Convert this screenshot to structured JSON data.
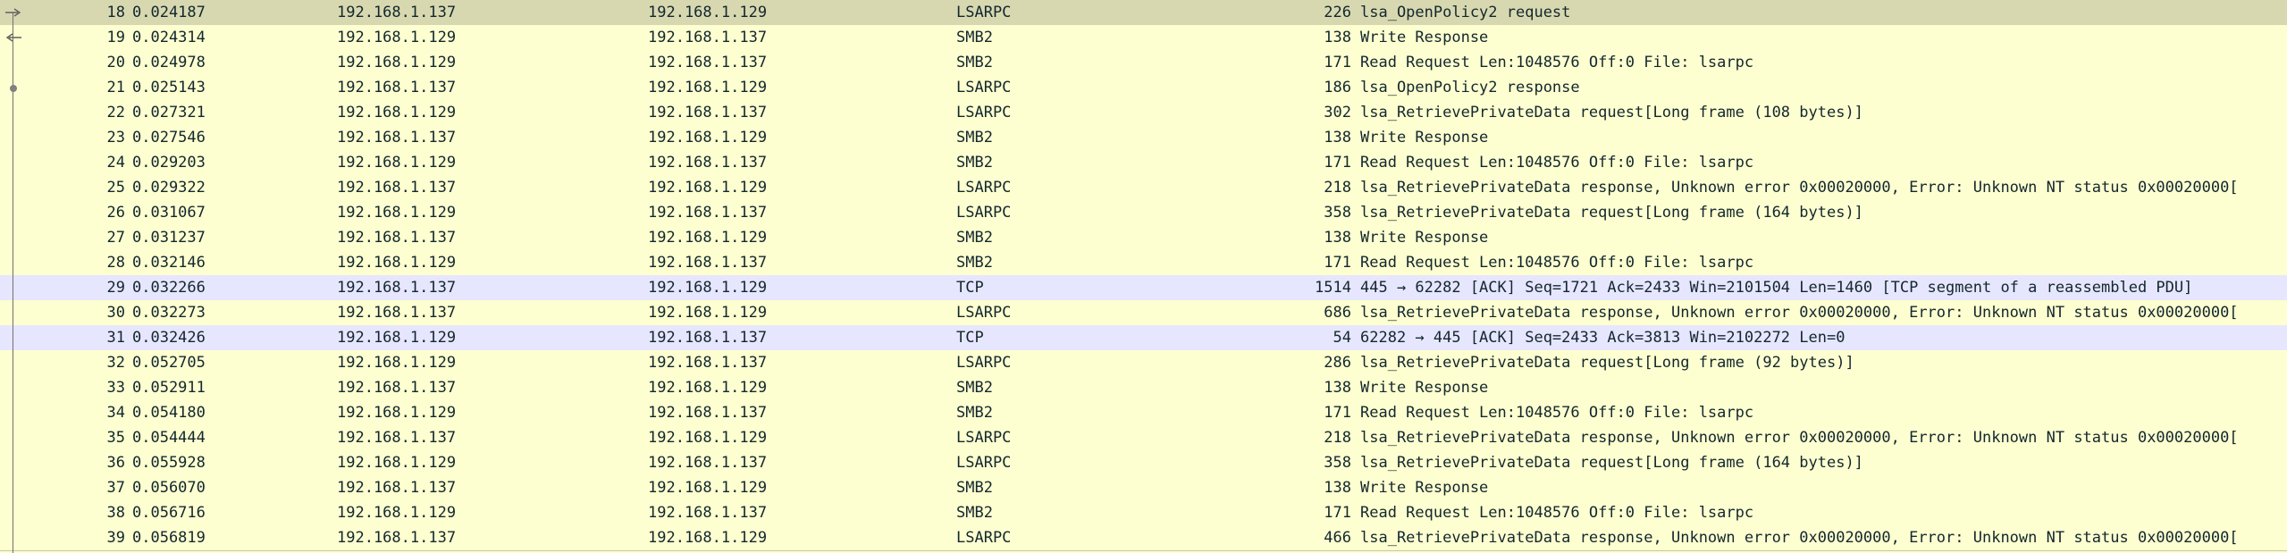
{
  "packet_list": {
    "rows": [
      {
        "no": "18",
        "time": "0.024187",
        "source": "192.168.1.137",
        "destination": "192.168.1.129",
        "protocol": "LSARPC",
        "length": "226",
        "info": "lsa_OpenPolicy2 request",
        "kind": "selected"
      },
      {
        "no": "19",
        "time": "0.024314",
        "source": "192.168.1.129",
        "destination": "192.168.1.137",
        "protocol": "SMB2",
        "length": "138",
        "info": "Write Response",
        "kind": "normal"
      },
      {
        "no": "20",
        "time": "0.024978",
        "source": "192.168.1.129",
        "destination": "192.168.1.137",
        "protocol": "SMB2",
        "length": "171",
        "info": "Read Request Len:1048576 Off:0 File: lsarpc",
        "kind": "normal"
      },
      {
        "no": "21",
        "time": "0.025143",
        "source": "192.168.1.137",
        "destination": "192.168.1.129",
        "protocol": "LSARPC",
        "length": "186",
        "info": "lsa_OpenPolicy2 response",
        "kind": "normal"
      },
      {
        "no": "22",
        "time": "0.027321",
        "source": "192.168.1.129",
        "destination": "192.168.1.137",
        "protocol": "LSARPC",
        "length": "302",
        "info": "lsa_RetrievePrivateData request[Long frame (108 bytes)]",
        "kind": "normal"
      },
      {
        "no": "23",
        "time": "0.027546",
        "source": "192.168.1.137",
        "destination": "192.168.1.129",
        "protocol": "SMB2",
        "length": "138",
        "info": "Write Response",
        "kind": "normal"
      },
      {
        "no": "24",
        "time": "0.029203",
        "source": "192.168.1.129",
        "destination": "192.168.1.137",
        "protocol": "SMB2",
        "length": "171",
        "info": "Read Request Len:1048576 Off:0 File: lsarpc",
        "kind": "normal"
      },
      {
        "no": "25",
        "time": "0.029322",
        "source": "192.168.1.137",
        "destination": "192.168.1.129",
        "protocol": "LSARPC",
        "length": "218",
        "info": "lsa_RetrievePrivateData response, Unknown error 0x00020000, Error: Unknown NT status 0x00020000[",
        "kind": "normal"
      },
      {
        "no": "26",
        "time": "0.031067",
        "source": "192.168.1.129",
        "destination": "192.168.1.137",
        "protocol": "LSARPC",
        "length": "358",
        "info": "lsa_RetrievePrivateData request[Long frame (164 bytes)]",
        "kind": "normal"
      },
      {
        "no": "27",
        "time": "0.031237",
        "source": "192.168.1.137",
        "destination": "192.168.1.129",
        "protocol": "SMB2",
        "length": "138",
        "info": "Write Response",
        "kind": "normal"
      },
      {
        "no": "28",
        "time": "0.032146",
        "source": "192.168.1.129",
        "destination": "192.168.1.137",
        "protocol": "SMB2",
        "length": "171",
        "info": "Read Request Len:1048576 Off:0 File: lsarpc",
        "kind": "normal"
      },
      {
        "no": "29",
        "time": "0.032266",
        "source": "192.168.1.137",
        "destination": "192.168.1.129",
        "protocol": "TCP",
        "length": "1514",
        "info": "445 → 62282 [ACK] Seq=1721 Ack=2433 Win=2101504 Len=1460 [TCP segment of a reassembled PDU]",
        "kind": "tcp"
      },
      {
        "no": "30",
        "time": "0.032273",
        "source": "192.168.1.137",
        "destination": "192.168.1.129",
        "protocol": "LSARPC",
        "length": "686",
        "info": "lsa_RetrievePrivateData response, Unknown error 0x00020000, Error: Unknown NT status 0x00020000[",
        "kind": "normal"
      },
      {
        "no": "31",
        "time": "0.032426",
        "source": "192.168.1.129",
        "destination": "192.168.1.137",
        "protocol": "TCP",
        "length": "54",
        "info": "62282 → 445 [ACK] Seq=2433 Ack=3813 Win=2102272 Len=0",
        "kind": "tcp"
      },
      {
        "no": "32",
        "time": "0.052705",
        "source": "192.168.1.129",
        "destination": "192.168.1.137",
        "protocol": "LSARPC",
        "length": "286",
        "info": "lsa_RetrievePrivateData request[Long frame (92 bytes)]",
        "kind": "normal"
      },
      {
        "no": "33",
        "time": "0.052911",
        "source": "192.168.1.137",
        "destination": "192.168.1.129",
        "protocol": "SMB2",
        "length": "138",
        "info": "Write Response",
        "kind": "normal"
      },
      {
        "no": "34",
        "time": "0.054180",
        "source": "192.168.1.129",
        "destination": "192.168.1.137",
        "protocol": "SMB2",
        "length": "171",
        "info": "Read Request Len:1048576 Off:0 File: lsarpc",
        "kind": "normal"
      },
      {
        "no": "35",
        "time": "0.054444",
        "source": "192.168.1.137",
        "destination": "192.168.1.129",
        "protocol": "LSARPC",
        "length": "218",
        "info": "lsa_RetrievePrivateData response, Unknown error 0x00020000, Error: Unknown NT status 0x00020000[",
        "kind": "normal"
      },
      {
        "no": "36",
        "time": "0.055928",
        "source": "192.168.1.129",
        "destination": "192.168.1.137",
        "protocol": "LSARPC",
        "length": "358",
        "info": "lsa_RetrievePrivateData request[Long frame (164 bytes)]",
        "kind": "normal"
      },
      {
        "no": "37",
        "time": "0.056070",
        "source": "192.168.1.137",
        "destination": "192.168.1.129",
        "protocol": "SMB2",
        "length": "138",
        "info": "Write Response",
        "kind": "normal"
      },
      {
        "no": "38",
        "time": "0.056716",
        "source": "192.168.1.129",
        "destination": "192.168.1.137",
        "protocol": "SMB2",
        "length": "171",
        "info": "Read Request Len:1048576 Off:0 File: lsarpc",
        "kind": "normal"
      },
      {
        "no": "39",
        "time": "0.056819",
        "source": "192.168.1.137",
        "destination": "192.168.1.129",
        "protocol": "LSARPC",
        "length": "466",
        "info": "lsa_RetrievePrivateData response, Unknown error 0x00020000, Error: Unknown NT status 0x00020000[",
        "kind": "normal"
      }
    ]
  },
  "icons": {
    "request": "request-arrow-icon",
    "response": "response-arrow-icon",
    "related": "related-packet-dot-icon"
  },
  "colors": {
    "row_default": "#feffd0",
    "row_tcp": "#e7e6ff",
    "row_selected": "#d8d8b0",
    "text": "#12272e"
  }
}
